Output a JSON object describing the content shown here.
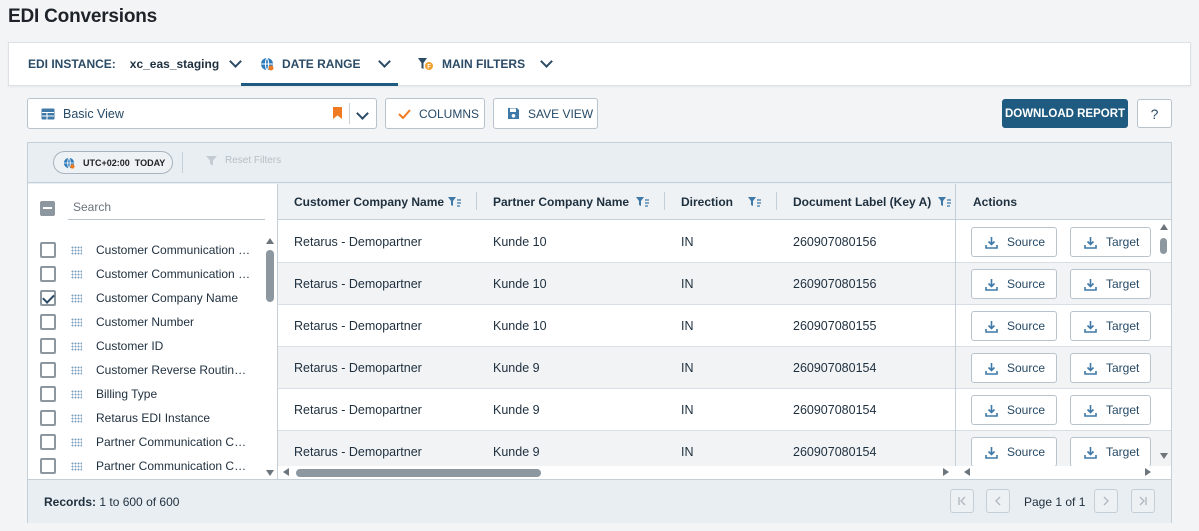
{
  "page": {
    "title": "EDI Conversions"
  },
  "filterbar": {
    "instance_label": "EDI INSTANCE:",
    "instance_value": "xc_eas_staging",
    "date_range_label": "DATE RANGE",
    "main_filters_label": "MAIN FILTERS"
  },
  "toolbar": {
    "view_name": "Basic View",
    "columns_label": "COLUMNS",
    "save_view_label": "SAVE VIEW",
    "download_label": "DOWNLOAD REPORT",
    "help_label": "?"
  },
  "grid": {
    "timezone": "UTC+02:00",
    "today_label": "TODAY",
    "reset_filters_label": "Reset Filters"
  },
  "column_panel": {
    "search_placeholder": "Search",
    "items": [
      {
        "label": "Customer Communication C...",
        "checked": false
      },
      {
        "label": "Customer Communication C...",
        "checked": false
      },
      {
        "label": "Customer Company Name",
        "checked": true
      },
      {
        "label": "Customer Number",
        "checked": false
      },
      {
        "label": "Customer ID",
        "checked": false
      },
      {
        "label": "Customer Reverse Routing A...",
        "checked": false
      },
      {
        "label": "Billing Type",
        "checked": false
      },
      {
        "label": "Retarus EDI Instance",
        "checked": false
      },
      {
        "label": "Partner Communication Cha...",
        "checked": false
      },
      {
        "label": "Partner Communication Cha...",
        "checked": false
      }
    ]
  },
  "table": {
    "headers": {
      "customer": "Customer Company Name",
      "partner": "Partner Company Name",
      "direction": "Direction",
      "doc_label": "Document Label (Key A)",
      "actions": "Actions"
    },
    "source_label": "Source",
    "target_label": "Target",
    "rows": [
      {
        "customer": "Retarus - Demopartner",
        "partner": "Kunde 10",
        "direction": "IN",
        "doc_label": "260907080156"
      },
      {
        "customer": "Retarus - Demopartner",
        "partner": "Kunde 10",
        "direction": "IN",
        "doc_label": "260907080156"
      },
      {
        "customer": "Retarus - Demopartner",
        "partner": "Kunde 10",
        "direction": "IN",
        "doc_label": "260907080155"
      },
      {
        "customer": "Retarus - Demopartner",
        "partner": "Kunde 9",
        "direction": "IN",
        "doc_label": "260907080154"
      },
      {
        "customer": "Retarus - Demopartner",
        "partner": "Kunde 9",
        "direction": "IN",
        "doc_label": "260907080154"
      },
      {
        "customer": "Retarus - Demopartner",
        "partner": "Kunde 9",
        "direction": "IN",
        "doc_label": "260907080154"
      }
    ]
  },
  "footer": {
    "records_label": "Records:",
    "records_value": "1 to 600 of 600",
    "page_info": "Page 1 of 1"
  },
  "colors": {
    "accent": "#1f5b80",
    "bookmark": "#f07a22",
    "columns_check": "#f07a22",
    "globe": "#2f7ab8"
  }
}
